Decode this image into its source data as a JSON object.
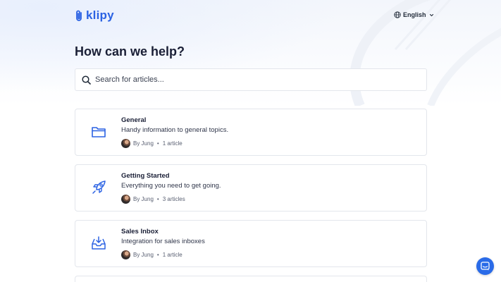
{
  "brand": {
    "name": "klipy",
    "color": "#2b62e3"
  },
  "header": {
    "language_label": "English"
  },
  "hero": {
    "title": "How can we help?"
  },
  "search": {
    "placeholder": "Search for articles..."
  },
  "collections": [
    {
      "title": "General",
      "description": "Handy information to general topics.",
      "author": "By Jung",
      "count": "1 article",
      "icon": "folder-icon"
    },
    {
      "title": "Getting Started",
      "description": "Everything you need to get going.",
      "author": "By Jung",
      "count": "3 articles",
      "icon": "rocket-icon"
    },
    {
      "title": "Sales Inbox",
      "description": "Integration for sales inboxes",
      "author": "By Jung",
      "count": "1 article",
      "icon": "inbox-icon"
    }
  ],
  "meta_separator": "•",
  "colors": {
    "accent": "#2a6be8",
    "icon_stroke": "#2b62e3"
  }
}
